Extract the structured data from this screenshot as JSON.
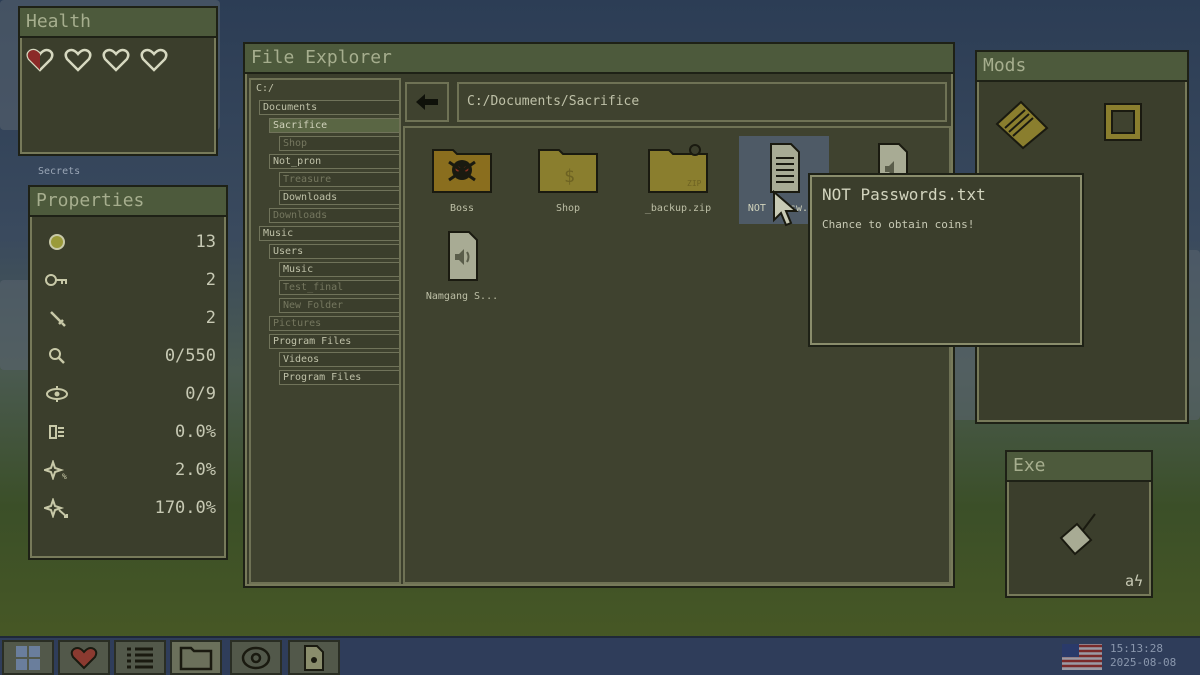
{
  "health": {
    "title": "Health",
    "hearts": [
      "half",
      "empty",
      "empty",
      "empty"
    ]
  },
  "desktop": {
    "secrets_label": "Secrets"
  },
  "properties": {
    "title": "Properties",
    "rows": [
      {
        "icon": "coin-icon",
        "value": "13"
      },
      {
        "icon": "key-icon",
        "value": "2"
      },
      {
        "icon": "sword-icon",
        "value": "2"
      },
      {
        "icon": "magnifier-icon",
        "value": "0/550"
      },
      {
        "icon": "eye-icon",
        "value": "0/9"
      },
      {
        "icon": "folder-list-icon",
        "value": "0.0%"
      },
      {
        "icon": "sparkle-percent-icon",
        "value": "2.0%"
      },
      {
        "icon": "sparkle-arrow-icon",
        "value": "170.0%"
      }
    ]
  },
  "explorer": {
    "title": "File Explorer",
    "path": "C:/Documents/Sacrifice",
    "tree": [
      {
        "label": "C:/",
        "state": "normal"
      },
      {
        "label": "Documents",
        "state": "normal"
      },
      {
        "label": "Sacrifice",
        "state": "selected"
      },
      {
        "label": "Shop",
        "state": "dim"
      },
      {
        "label": "Not_pron",
        "state": "normal"
      },
      {
        "label": "Treasure",
        "state": "dim"
      },
      {
        "label": "Downloads",
        "state": "normal"
      },
      {
        "label": "Downloads",
        "state": "dim"
      },
      {
        "label": "Music",
        "state": "normal"
      },
      {
        "label": "Users",
        "state": "normal"
      },
      {
        "label": "Music",
        "state": "normal"
      },
      {
        "label": "Test_final",
        "state": "dim"
      },
      {
        "label": "New Folder",
        "state": "dim"
      },
      {
        "label": "Pictures",
        "state": "dim"
      },
      {
        "label": "Program Files",
        "state": "normal"
      },
      {
        "label": "Videos",
        "state": "normal"
      },
      {
        "label": "Program Files",
        "state": "normal"
      }
    ],
    "files": [
      {
        "label": "Boss",
        "icon": "skull-folder-icon"
      },
      {
        "label": "Shop",
        "icon": "money-folder-icon"
      },
      {
        "label": "_backup.zip",
        "icon": "zip-folder-icon"
      },
      {
        "label": "NOT Passw...",
        "icon": "text-file-icon"
      },
      {
        "label": "",
        "icon": "audio-file-icon"
      },
      {
        "label": "Namgang S...",
        "icon": "audio-file-icon"
      }
    ]
  },
  "tooltip": {
    "title": "NOT Passwords.txt",
    "body": "Chance to obtain coins!"
  },
  "mods": {
    "title": "Mods"
  },
  "exe": {
    "title": "Exe",
    "footer": "aϟ"
  },
  "taskbar": {
    "time": "15:13:28",
    "date": "2025-08-08"
  },
  "colors": {
    "window_bg": "#3b3e2c",
    "titlebar": "#4d5a3c",
    "taskbar": "#2f3d5a",
    "text": "#c7c9b4"
  }
}
